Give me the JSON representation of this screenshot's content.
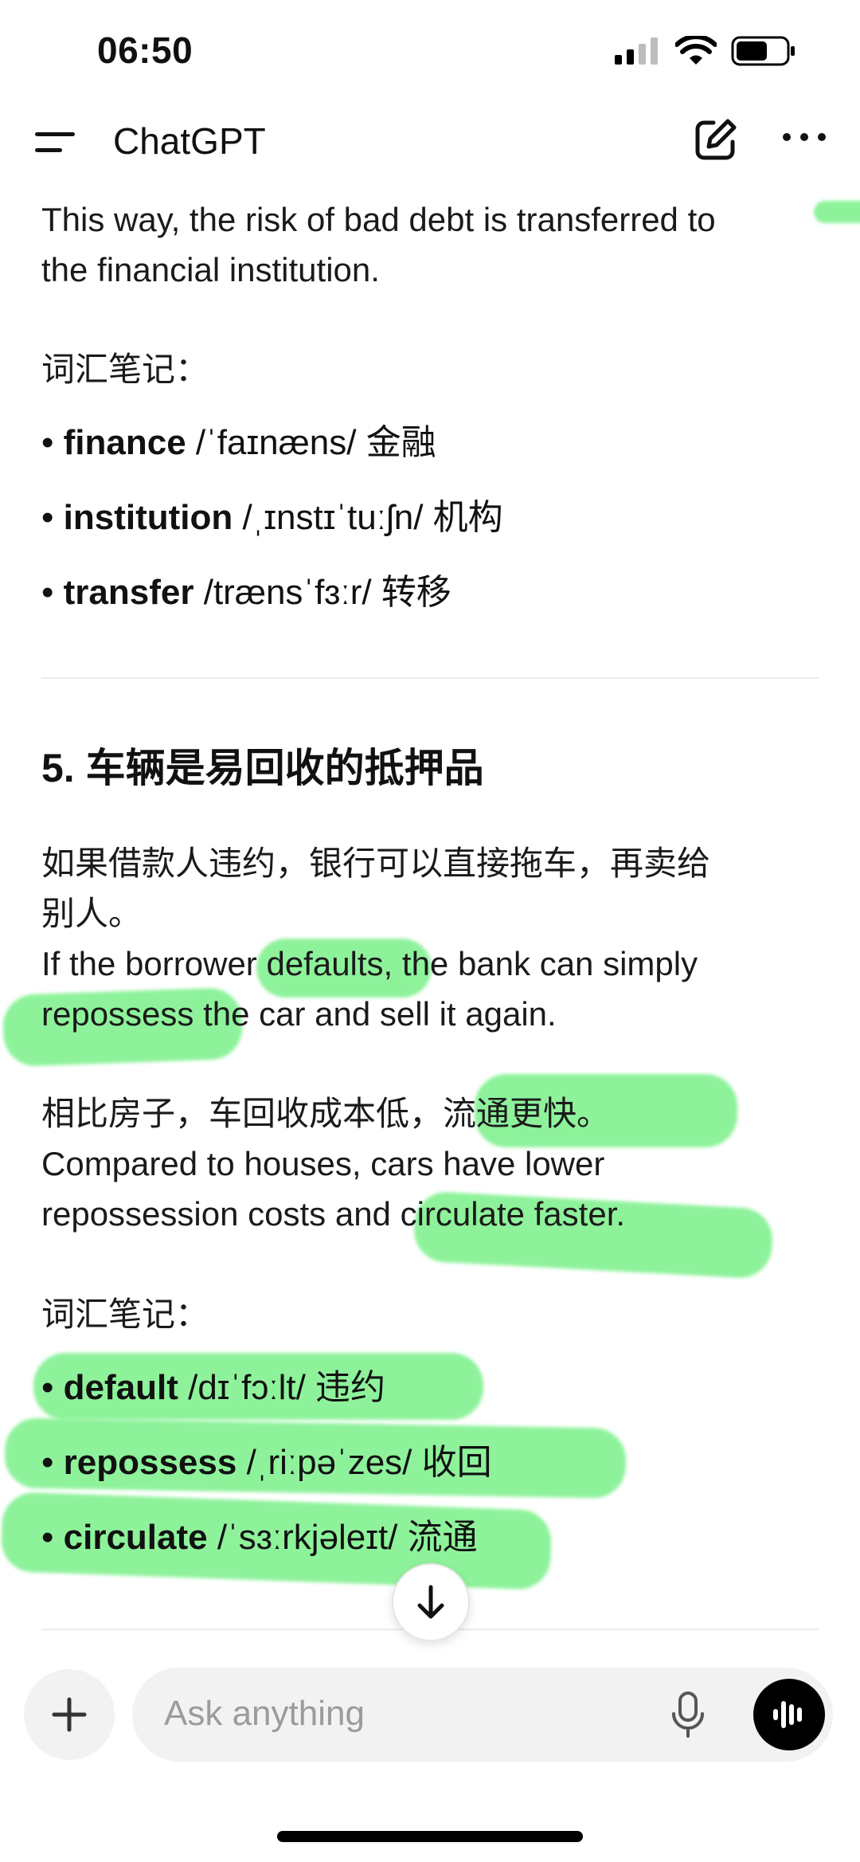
{
  "status_bar": {
    "time": "06:50"
  },
  "app": {
    "title": "ChatGPT"
  },
  "content": {
    "para_top_en_line1": "This way, the risk of bad debt is transferred to",
    "para_top_en_line2": "the financial institution.",
    "vocab_label_1": "词汇笔记：",
    "vocab1": [
      {
        "word": "finance",
        "ipa": "/ˈfaɪnæns/",
        "meaning": "金融"
      },
      {
        "word": "institution",
        "ipa": "/ˌɪnstɪˈtuːʃn/",
        "meaning": "机构"
      },
      {
        "word": "transfer",
        "ipa": "/trænsˈfɜːr/",
        "meaning": "转移"
      }
    ],
    "section5_title": "5. 车辆是易回收的抵押品",
    "p1_cn_line1": "如果借款人违约，银行可以直接拖车，再卖给",
    "p1_cn_line2": "别人。",
    "p1_en_line1": "If the borrower defaults, the bank can simply",
    "p1_en_line2": "repossess the car and sell it again.",
    "p2_cn": "相比房子，车回收成本低，流通更快。",
    "p2_en_line1": "Compared to houses, cars have lower",
    "p2_en_line2": "repossession costs and circulate faster.",
    "vocab_label_2": "词汇笔记：",
    "vocab2": [
      {
        "word": "default",
        "ipa": "/dɪˈfɔːlt/",
        "meaning": "违约"
      },
      {
        "word": "repossess",
        "ipa": "/ˌriːpəˈzes/",
        "meaning": "收回"
      },
      {
        "word": "circulate",
        "ipa": "/ˈsɜːrkjəleɪt/",
        "meaning": "流通"
      }
    ]
  },
  "composer": {
    "placeholder": "Ask anything"
  },
  "icons": {
    "menu": "menu-icon",
    "edit": "new-chat-edit-icon",
    "more": "more-icon",
    "scroll": "arrow-down-icon",
    "plus": "plus-icon",
    "mic": "microphone-icon",
    "voice": "voice-waveform-icon"
  },
  "colors": {
    "highlight": "#7bf08a",
    "text": "#1a1a1a",
    "placeholder": "#9b9b9b"
  }
}
